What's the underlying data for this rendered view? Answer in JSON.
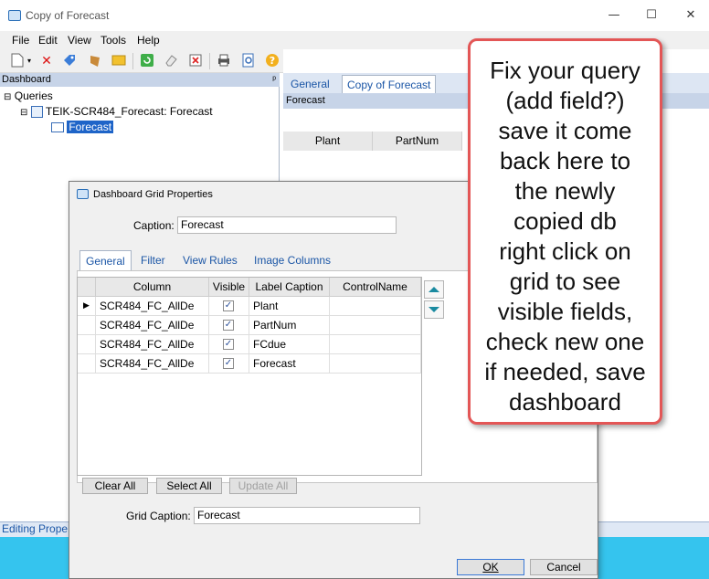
{
  "window": {
    "title": "Copy of Forecast",
    "controls": {
      "minimize": "—",
      "maximize": "☐",
      "close": "✕"
    }
  },
  "menubar": [
    "File",
    "Edit",
    "View",
    "Tools",
    "Help"
  ],
  "toolbar": {
    "icons": [
      "new-icon",
      "dropdown-icon",
      "delete-icon",
      "tag-icon",
      "folder-icon",
      "refresh-icon",
      "eraser-icon",
      "properties-icon",
      "print-icon",
      "preview-icon",
      "help-icon"
    ]
  },
  "dashboard_pane": {
    "header": "Dashboard",
    "pin": "ᵖ",
    "tree": {
      "root": "Queries",
      "query": "TEIK-SCR484_Forecast: Forecast",
      "selected_item": "Forecast"
    }
  },
  "right_pane": {
    "tabs": [
      "General",
      "Copy of Forecast"
    ],
    "active_tab": "Copy of Forecast",
    "header": "Forecast",
    "grid_columns": [
      "Plant",
      "PartNum"
    ]
  },
  "status_bar": {
    "text": "Editing Prope"
  },
  "dialog": {
    "title": "Dashboard Grid Properties",
    "caption_label": "Caption:",
    "caption_value": "Forecast",
    "tabs": [
      "General",
      "Filter",
      "View Rules",
      "Image Columns"
    ],
    "active_tab": "General",
    "grid": {
      "headers": [
        "Column",
        "Visible",
        "Label Caption",
        "ControlName"
      ],
      "rows": [
        {
          "column": "SCR484_FC_AllDe",
          "visible": "✓",
          "label": "Plant",
          "control": ""
        },
        {
          "column": "SCR484_FC_AllDe",
          "visible": "✓",
          "label": "PartNum",
          "control": ""
        },
        {
          "column": "SCR484_FC_AllDe",
          "visible": "✓",
          "label": "FCdue",
          "control": ""
        },
        {
          "column": "SCR484_FC_AllDe",
          "visible": "✓",
          "label": "Forecast",
          "control": ""
        }
      ]
    },
    "buttons": {
      "clear_all": "Clear All",
      "select_all": "Select All",
      "update_all": "Update All"
    },
    "grid_caption_label": "Grid Caption:",
    "grid_caption_value": "Forecast",
    "ok": "OK",
    "cancel": "Cancel"
  },
  "callout": {
    "lines": [
      "Fix your query",
      "(add field?)",
      "save it come",
      "back here to",
      "the newly",
      "copied db",
      "right click on",
      "grid to see",
      "visible fields,",
      "check new one",
      "if needed, save",
      "dashboard"
    ]
  },
  "colors": {
    "accent": "#1b56a6",
    "pane_header": "#c7d4e8",
    "callout_border": "#e35656",
    "bottom_fill": "#35c4ee"
  }
}
